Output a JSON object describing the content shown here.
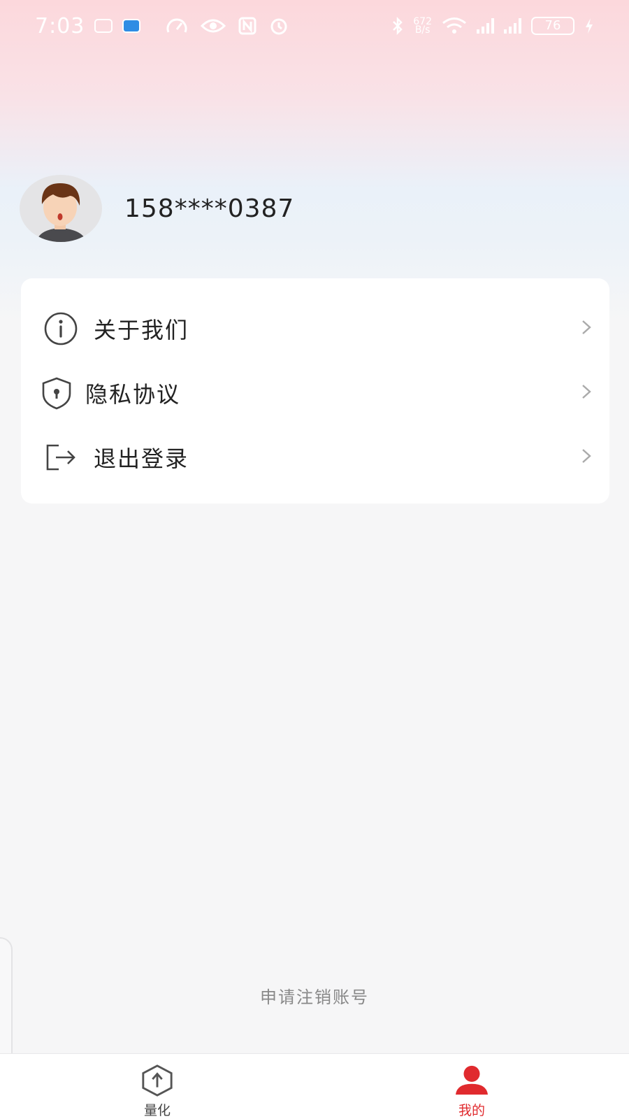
{
  "status_bar": {
    "time": "7:03",
    "speed": "672",
    "speed_unit": "B/s",
    "battery": "76"
  },
  "profile": {
    "phone": "158****0387"
  },
  "menu": {
    "items": [
      {
        "label": "关于我们",
        "icon": "info-icon"
      },
      {
        "label": "隐私协议",
        "icon": "shield-lock-icon"
      },
      {
        "label": "退出登录",
        "icon": "logout-icon"
      }
    ]
  },
  "footer": {
    "cancel_account": "申请注销账号"
  },
  "tabbar": {
    "tabs": [
      {
        "label": "量化",
        "icon": "quant-hexagon-icon",
        "active": false
      },
      {
        "label": "我的",
        "icon": "person-icon",
        "active": true
      }
    ]
  },
  "colors": {
    "accent": "#e02a2e",
    "text": "#222222",
    "muted": "#888888",
    "card": "#ffffff"
  }
}
